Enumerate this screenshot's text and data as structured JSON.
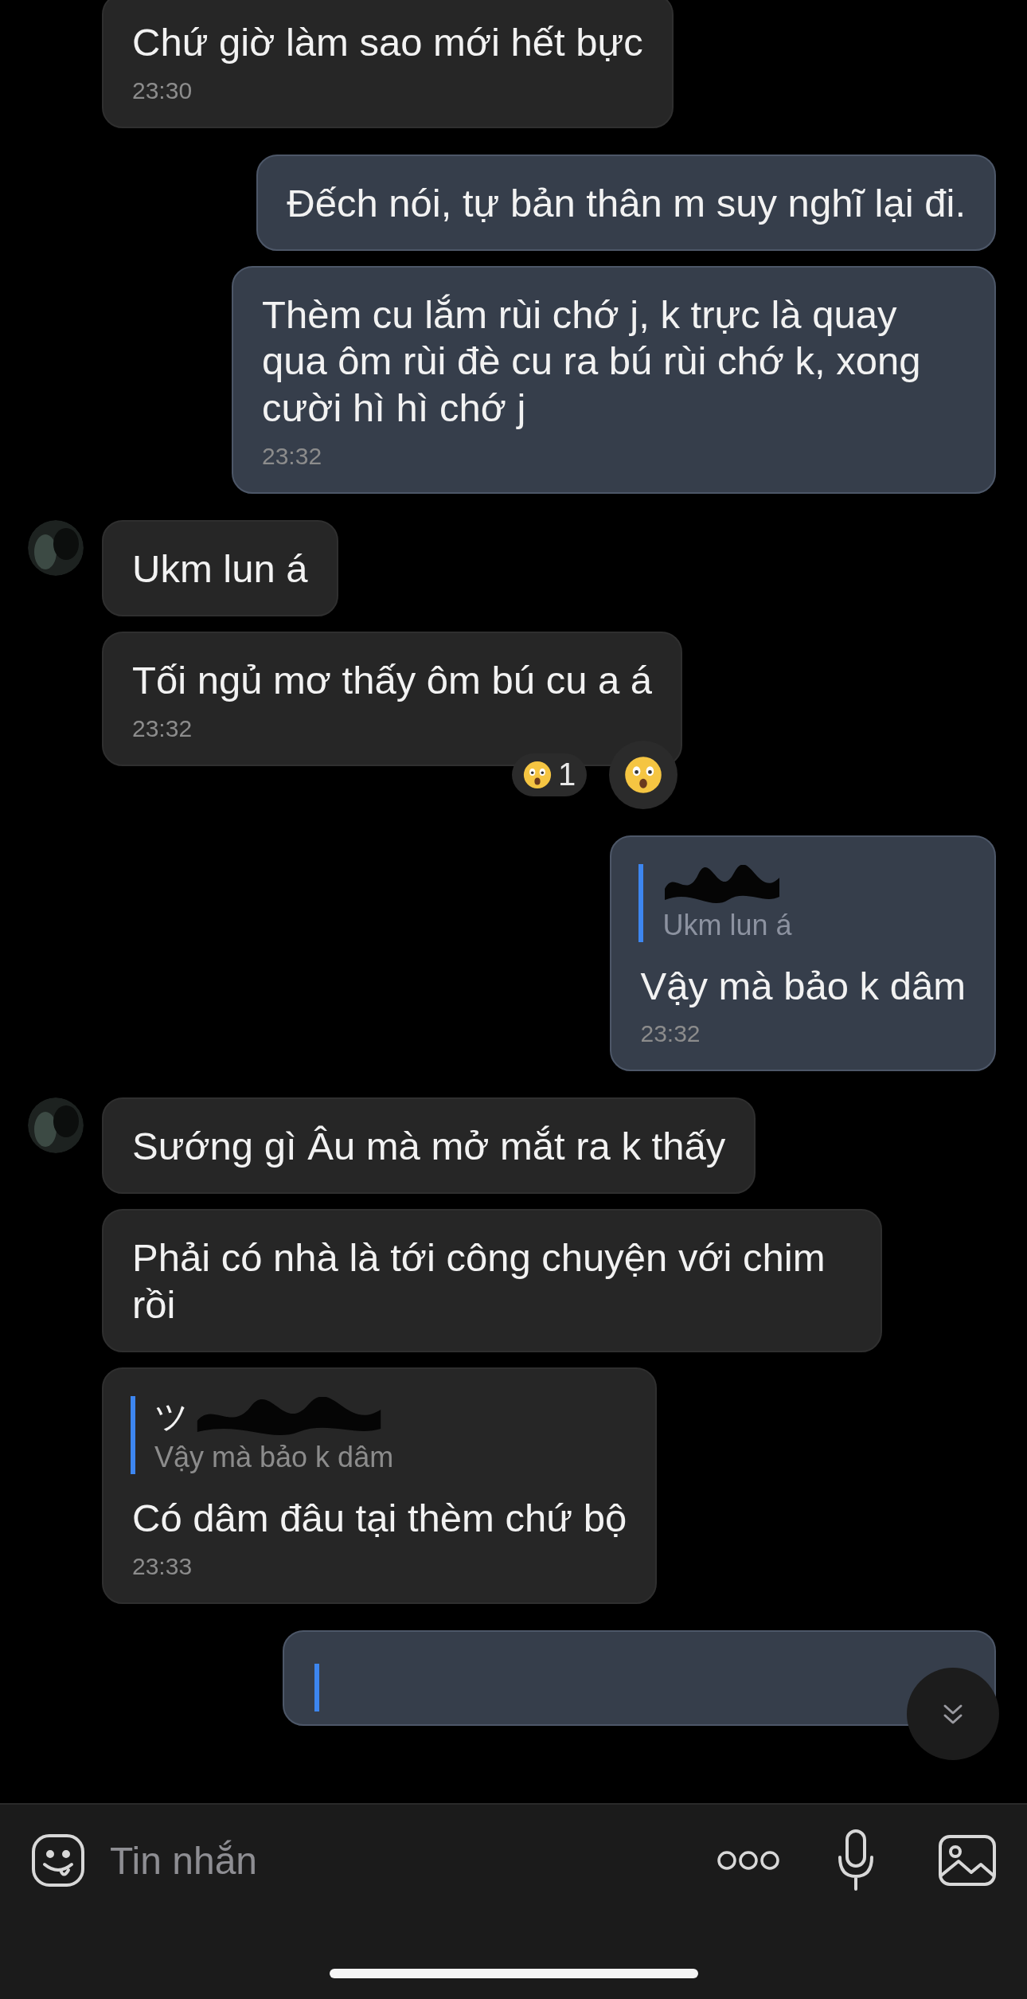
{
  "messages": [
    {
      "kind": "text",
      "outgoing": false,
      "avatar": false,
      "text": "Chứ giờ làm sao mới hết bực",
      "time": "23:30"
    },
    {
      "kind": "text",
      "outgoing": true,
      "text": "Đếch nói, tự bản thân m suy nghĩ lại đi."
    },
    {
      "kind": "text",
      "outgoing": true,
      "text": "Thèm cu lắm rùi chớ j, k trực là quay qua ôm rùi đè cu ra bú rùi chớ k, xong cười hì hì chớ j",
      "time": "23:32"
    },
    {
      "kind": "text",
      "outgoing": false,
      "avatar": true,
      "text": "Ukm lun á"
    },
    {
      "kind": "text",
      "outgoing": false,
      "avatar": false,
      "text": "Tối ngủ mơ thấy ôm bú cu a á",
      "time": "23:32",
      "reactions": [
        {
          "count": "1"
        }
      ],
      "react_button": true
    },
    {
      "kind": "text",
      "outgoing": true,
      "quote": {
        "sender_redacted": true,
        "text": "Ukm lun á"
      },
      "text": "Vậy mà bảo k dâm",
      "time": "23:32"
    },
    {
      "kind": "text",
      "outgoing": false,
      "avatar": true,
      "text": "Sướng gì Âu mà mở mắt ra k thấy"
    },
    {
      "kind": "text",
      "outgoing": false,
      "avatar": false,
      "text": "Phải có nhà là tới công chuyện với chim rồi"
    },
    {
      "kind": "text",
      "outgoing": false,
      "avatar": false,
      "quote": {
        "sender": "ツ",
        "sender_redacted": true,
        "text": "Vậy mà bảo k dâm"
      },
      "text": "Có dâm đâu tại thèm chứ bộ",
      "time": "23:33"
    },
    {
      "kind": "cut",
      "outgoing": true
    }
  ],
  "composer": {
    "placeholder": "Tin nhắn"
  }
}
